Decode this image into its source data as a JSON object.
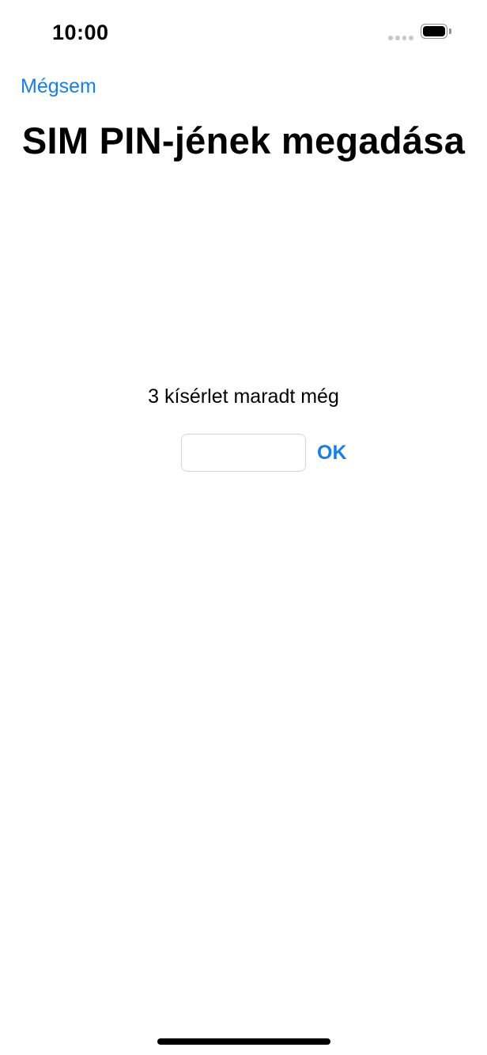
{
  "status_bar": {
    "time": "10:00",
    "signal_icon": "cellular-signal-dots-icon",
    "battery_icon": "battery-full-icon",
    "battery_level": 1.0
  },
  "nav": {
    "cancel_label": "Mégsem"
  },
  "title": "SIM PIN-jének megadása",
  "attempts_remaining_text": "3 kísérlet maradt még",
  "pin_field": {
    "value": "",
    "placeholder": ""
  },
  "ok_label": "OK",
  "colors": {
    "accent": "#1a7fe0",
    "background": "#ffffff",
    "text": "#000000"
  }
}
